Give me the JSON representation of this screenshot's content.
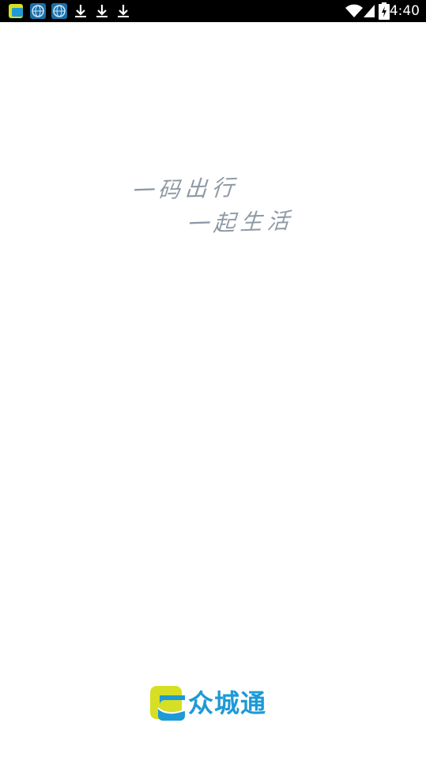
{
  "status_bar": {
    "time": "4:40",
    "notifications": [
      "app-notification-icon",
      "vpn-globe-icon",
      "vpn-globe-icon",
      "download-icon",
      "download-icon",
      "download-icon"
    ],
    "system_icons": [
      "wifi-icon",
      "signal-icon",
      "battery-charging-icon"
    ]
  },
  "splash": {
    "slogan_line1": "一码出行",
    "slogan_line2": "一起生活"
  },
  "brand": {
    "name": "众城通"
  },
  "colors": {
    "status_bar_bg": "#000000",
    "background": "#ffffff",
    "slogan_text": "#8e9aa6",
    "brand_blue": "#1e9ad6",
    "brand_yellow": "#d7df24"
  }
}
